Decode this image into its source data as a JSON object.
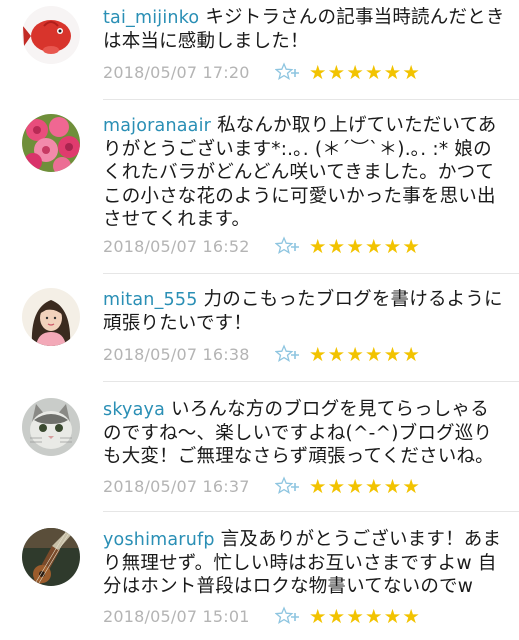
{
  "comments": [
    {
      "username": "tai_mijinko",
      "text": "キジトラさんの記事当時読んだときは本当に感動しました！",
      "date": "2018/05/07 17:20",
      "stars": "★★★★★★",
      "avatar": "red-fish-avatar"
    },
    {
      "username": "majoranaair",
      "text": "私なんか取り上げていただいてありがとうございます*:.｡. (＊´︶`＊).｡. :* 娘のくれたバラがどんどん咲いてきました。かつてこの小さな花のように可愛いかった事を思い出させてくれます。",
      "date": "2018/05/07 16:52",
      "stars": "★★★★★★",
      "avatar": "pink-roses-avatar"
    },
    {
      "username": "mitan_555",
      "text": "力のこもったブログを書けるように頑張りたいです！",
      "date": "2018/05/07 16:38",
      "stars": "★★★★★★",
      "avatar": "woman-portrait-avatar"
    },
    {
      "username": "skyaya",
      "text": "いろんな方のブログを見てらっしゃるのですね〜、楽しいですよね(^-^)ブログ巡りも大変！ご無理なさらず頑張ってくださいね。",
      "date": "2018/05/07 16:37",
      "stars": "★★★★★★",
      "avatar": "cat-avatar"
    },
    {
      "username": "yoshimarufp",
      "text": "言及ありがとうございます！あまり無理せず。忙しい時はお互いさまですよw 自分はホント普段はロクな物書いてないのでw",
      "date": "2018/05/07 15:01",
      "stars": "★★★★★★",
      "avatar": "guitar-avatar"
    }
  ],
  "icons": {
    "add_star": "add-star-icon"
  },
  "colors": {
    "username": "#2a8fb5",
    "star": "#f2c300",
    "date": "#b4b4b4"
  }
}
